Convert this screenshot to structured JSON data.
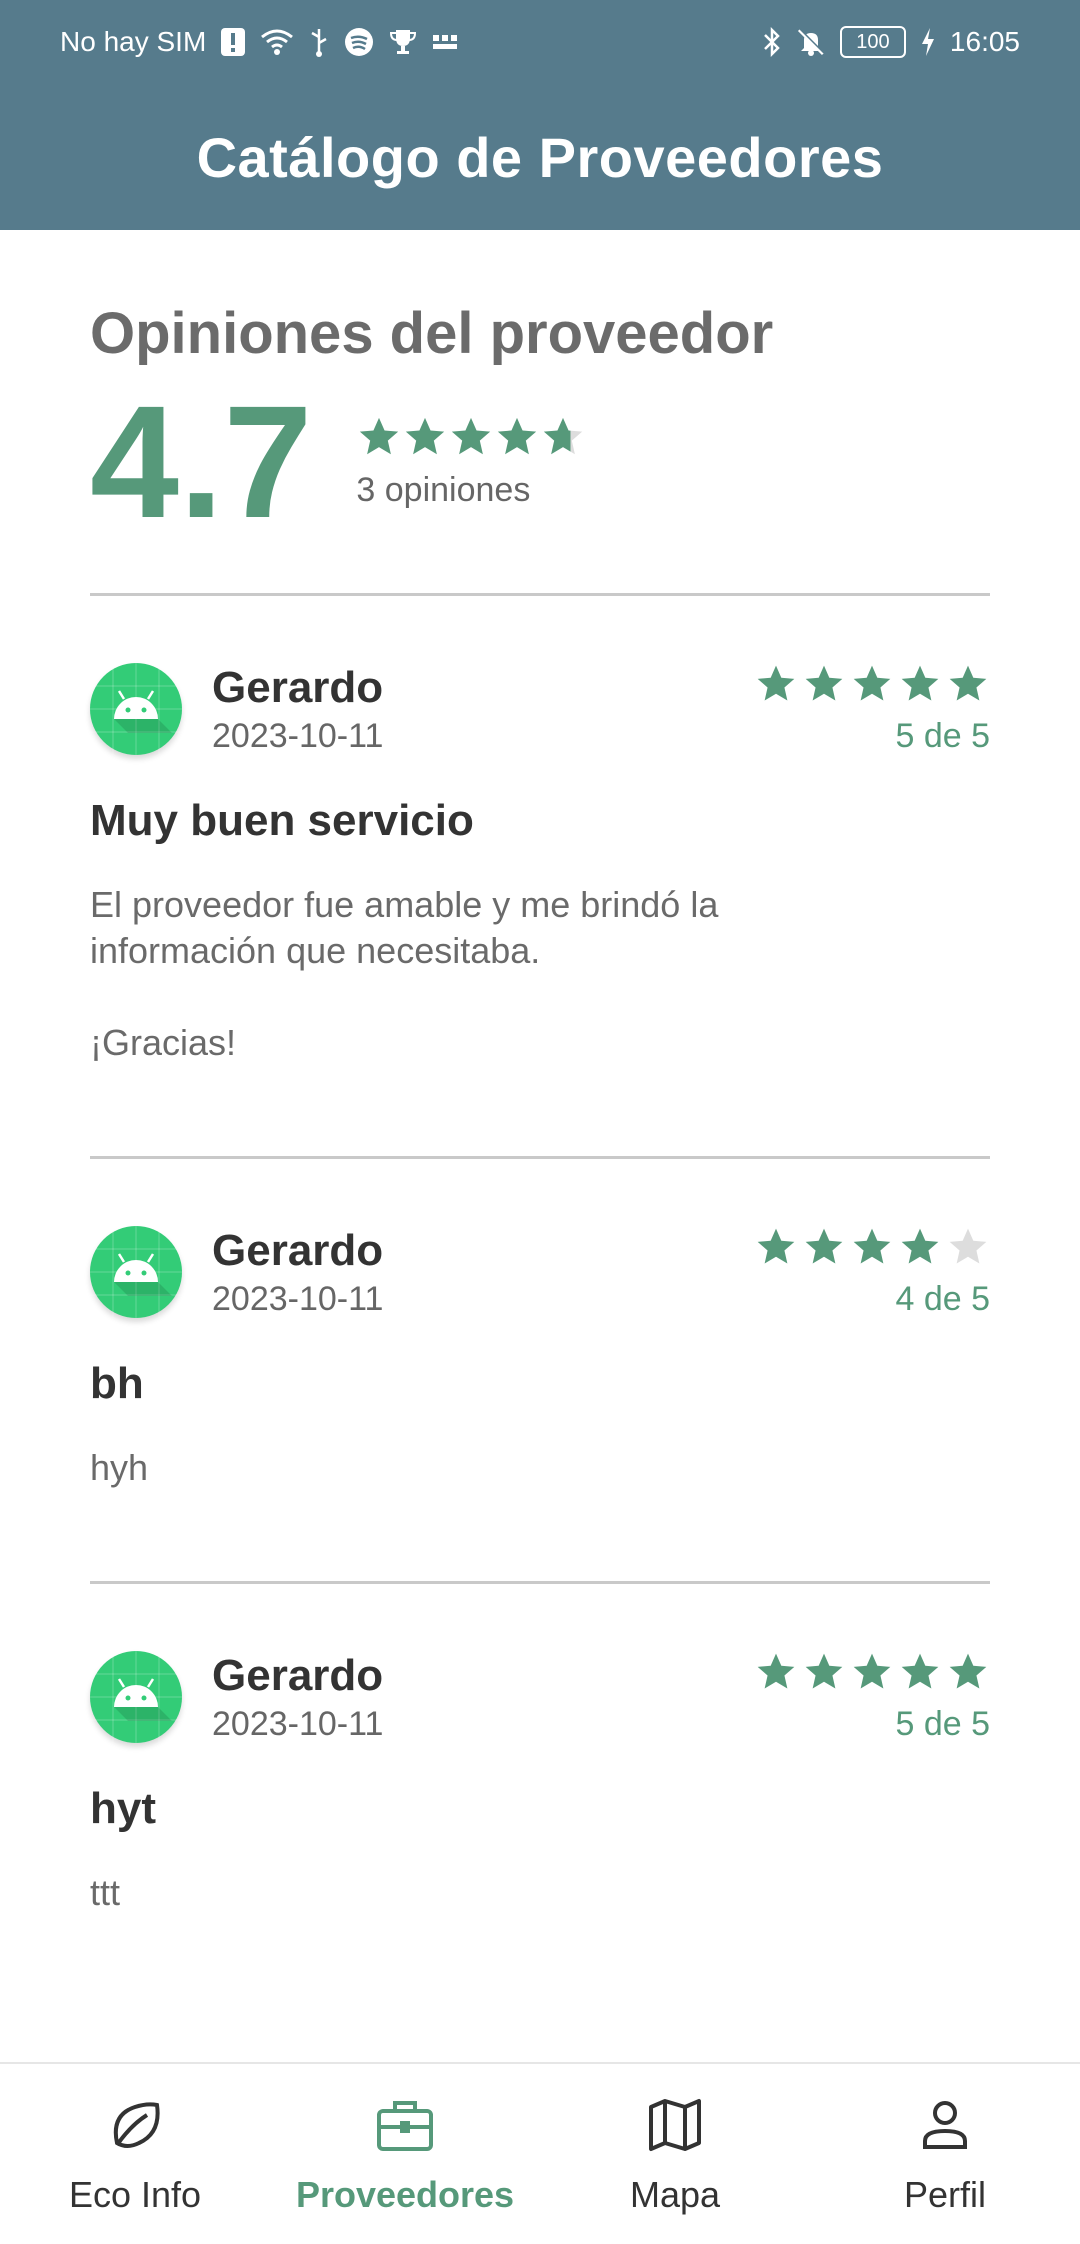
{
  "status_bar": {
    "carrier": "No hay SIM",
    "battery": "100",
    "time": "16:05"
  },
  "app_bar": {
    "title": "Catálogo de Proveedores"
  },
  "summary": {
    "title": "Opiniones del proveedor",
    "average": "4.7",
    "average_value": 4.7,
    "count_text": "3 opiniones"
  },
  "reviews": [
    {
      "name": "Gerardo",
      "date": "2023-10-11",
      "rating": 5,
      "rating_text": "5 de 5",
      "title": "Muy buen servicio",
      "body": "El proveedor fue amable y me brindó la\ninformación que necesitaba.\n\n¡Gracias!"
    },
    {
      "name": "Gerardo",
      "date": "2023-10-11",
      "rating": 4,
      "rating_text": "4 de 5",
      "title": "bh",
      "body": "hyh"
    },
    {
      "name": "Gerardo",
      "date": "2023-10-11",
      "rating": 5,
      "rating_text": "5 de 5",
      "title": "hyt",
      "body": "ttt"
    }
  ],
  "bottom_nav": [
    {
      "label": "Eco Info",
      "icon": "leaf-icon",
      "active": false
    },
    {
      "label": "Proveedores",
      "icon": "briefcase-icon",
      "active": true
    },
    {
      "label": "Mapa",
      "icon": "map-icon",
      "active": false
    },
    {
      "label": "Perfil",
      "icon": "person-icon",
      "active": false
    }
  ],
  "colors": {
    "app_bar": "#567b8c",
    "accent": "#56997a",
    "star_empty": "#dddddd"
  }
}
